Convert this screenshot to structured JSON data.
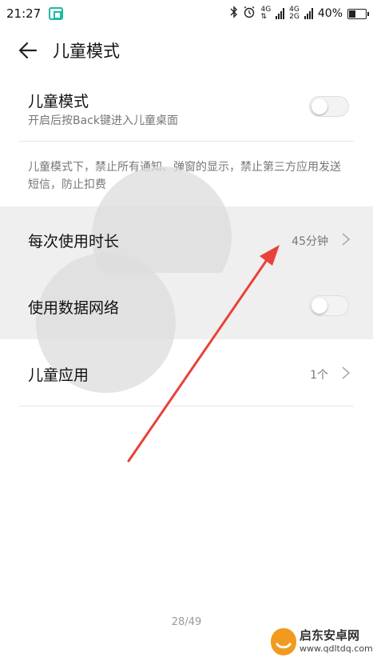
{
  "status_bar": {
    "time": "21:27",
    "net1": "4G",
    "net2_top": "4G",
    "net2_bottom": "2G",
    "battery": "40%",
    "battery_level": 0.4
  },
  "header": {
    "title": "儿童模式"
  },
  "kids_mode": {
    "title": "儿童模式",
    "subtitle": "开启后按Back键进入儿童桌面",
    "enabled": false
  },
  "note": "儿童模式下，禁止所有通知、弹窗的显示，禁止第三方应用发送短信，防止扣费",
  "rows": {
    "duration": {
      "label": "每次使用时长",
      "value": "45分钟"
    },
    "mobile_data": {
      "label": "使用数据网络",
      "enabled": false
    },
    "apps": {
      "label": "儿童应用",
      "value": "1个"
    }
  },
  "page_counter": "28/49",
  "watermark": {
    "text": "启东安卓网",
    "url": "www.qdltdq.com"
  },
  "colors": {
    "annotation_arrow": "#e8423a",
    "badge": "#1fb9a4"
  }
}
